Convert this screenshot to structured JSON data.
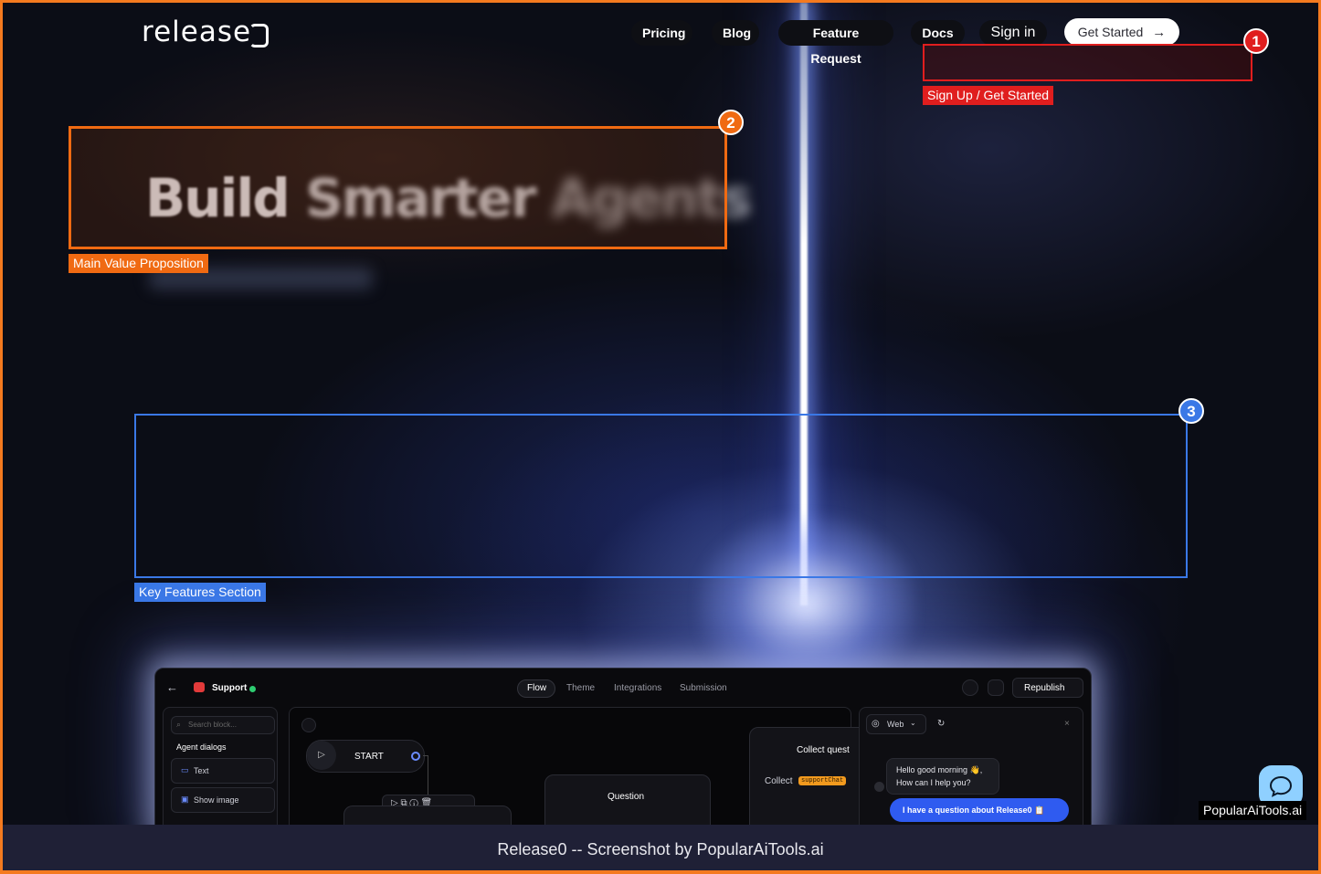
{
  "nav": {
    "logo_text": "release",
    "items": [
      "Pricing",
      "Blog",
      "Feature Request",
      "Docs"
    ],
    "sign_in": "Sign in",
    "cta_label": "Get Started"
  },
  "hero": {
    "title_words": [
      "Build",
      "Smarter",
      "Agents"
    ]
  },
  "annotations": [
    {
      "number": "1",
      "label": "Sign Up / Get Started",
      "color": "#e01e1e"
    },
    {
      "number": "2",
      "label": "Main Value Proposition",
      "color": "#f06a12"
    },
    {
      "number": "3",
      "label": "Key Features Section",
      "color": "#3a78e6"
    }
  ],
  "app_preview": {
    "title": "Support",
    "tabs": [
      "Flow",
      "Theme",
      "Integrations",
      "Submission"
    ],
    "republish": "Republish",
    "search_placeholder": "Search block...",
    "section_heading": "Agent dialogs",
    "blocks": [
      "Text",
      "Show image"
    ],
    "nodes": {
      "start": "START",
      "question": "Question",
      "collect_heading": "Collect quest",
      "collect_label": "Collect",
      "collect_tag": "supportChat"
    },
    "preview_channel": "Web",
    "chat_message_line1": "Hello good morning 👋,",
    "chat_message_line2": "How can I help you?",
    "chat_reply": "I have a question about Release0 📋"
  },
  "watermark": "PopularAiTools.ai",
  "footer_caption": "Release0 -- Screenshot by PopularAiTools.ai",
  "colors": {
    "frame": "#f47a1f",
    "footer_bg": "#1f2036",
    "reply_blue": "#2f5bf0"
  }
}
